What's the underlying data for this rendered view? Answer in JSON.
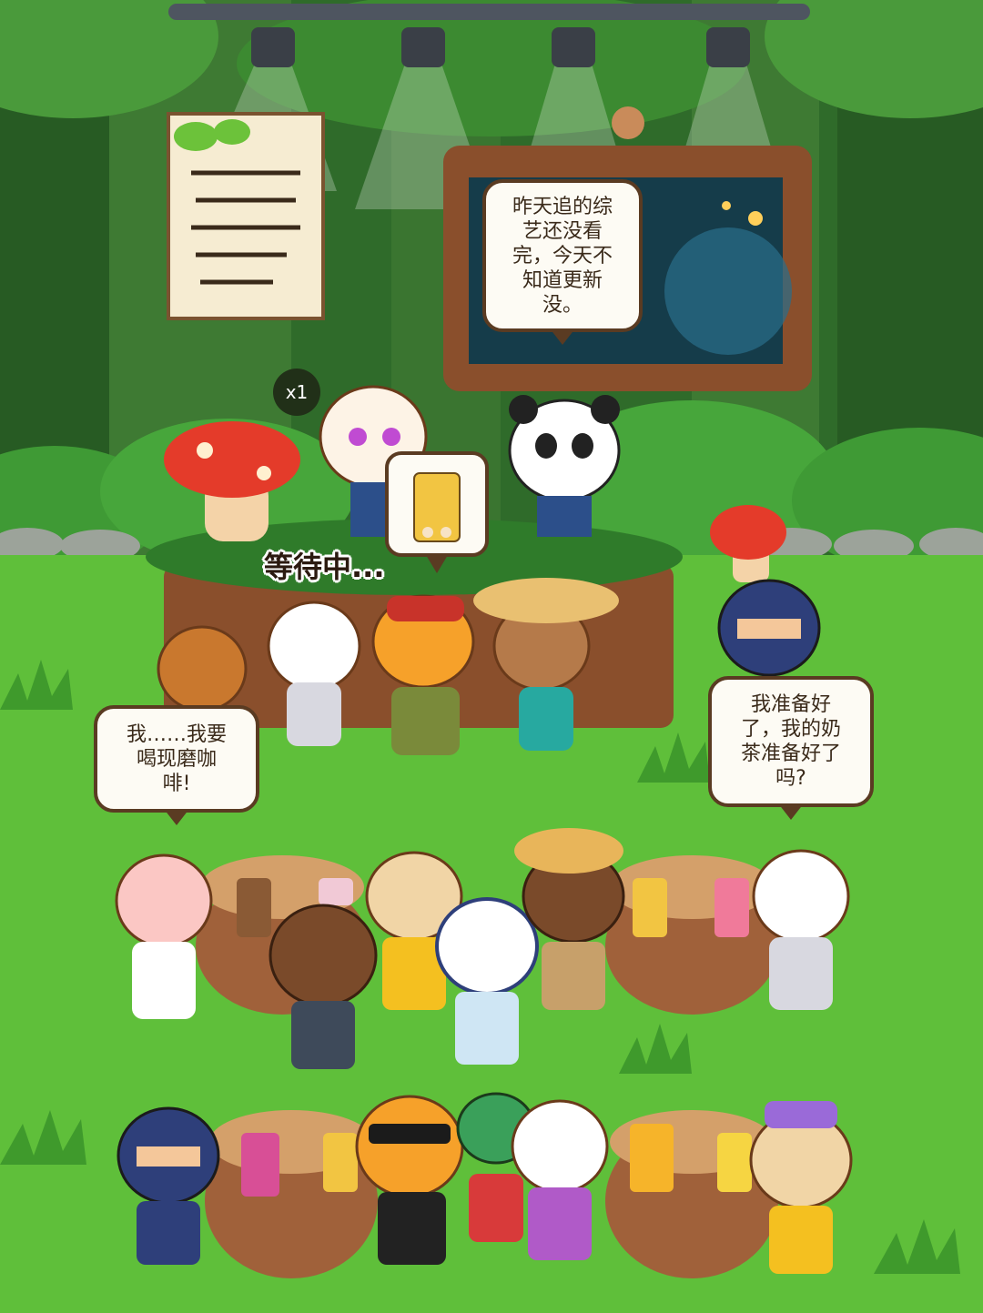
{
  "speech_bubbles": {
    "tv": "昨天追的综\n艺还没看\n完，今天不\n知道更新\n没。",
    "left": "我……我要\n喝现磨咖\n啡!",
    "right": "我准备好\n了，我的奶\n茶准备好了\n吗?"
  },
  "status": {
    "waiting": "等待中...",
    "multiplier": "x1"
  },
  "colors": {
    "grass": "#5fbf3a",
    "forest_dark": "#2f6b2a",
    "wood": "#8a4f2c",
    "bubble_border": "#5a3b22"
  }
}
